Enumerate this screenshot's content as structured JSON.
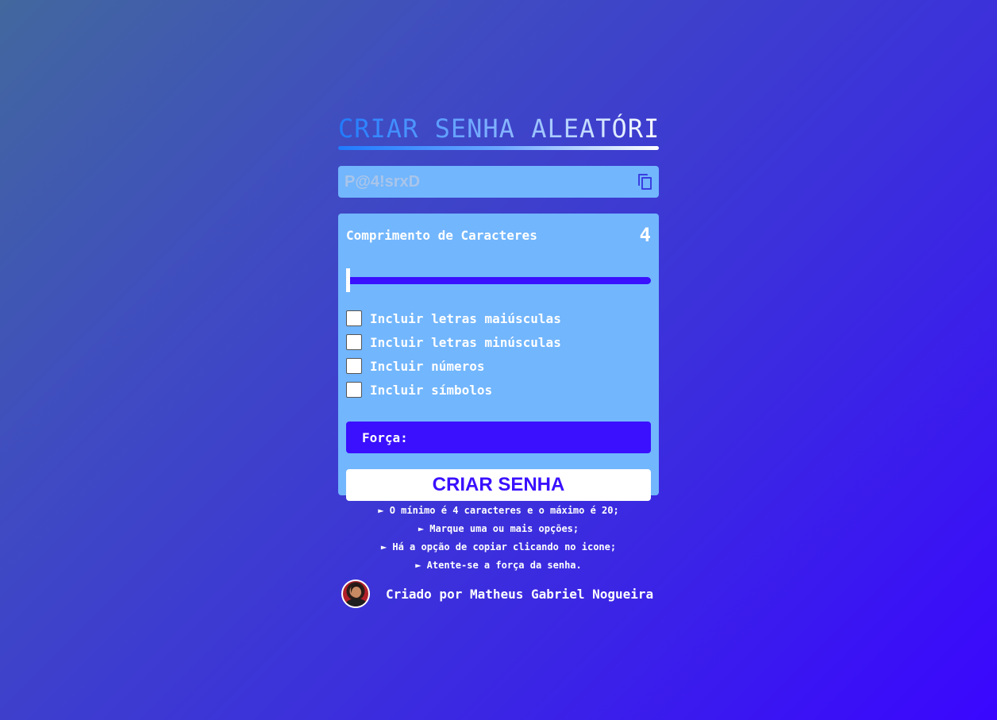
{
  "header": {
    "title": "CRIAR SENHA ALEATÓRIA"
  },
  "password": {
    "value": "P@4!srxD",
    "copy_icon": "copy-icon"
  },
  "settings": {
    "length_label": "Comprimento de Caracteres",
    "length_value": "4",
    "slider": {
      "min": 4,
      "max": 20,
      "value": 4
    },
    "options": [
      {
        "label": "Incluir letras maiúsculas",
        "checked": false
      },
      {
        "label": "Incluir letras minúsculas",
        "checked": false
      },
      {
        "label": "Incluir números",
        "checked": false
      },
      {
        "label": "Incluir símbolos",
        "checked": false
      }
    ],
    "strength_label": "Força:",
    "generate_label": "CRIAR SENHA"
  },
  "tips": [
    "► O mínimo é 4 caracteres e o máximo é 20;",
    "► Marque uma ou mais opções;",
    "► Há a opção de copiar clicando no icone;",
    "► Atente-se a força da senha."
  ],
  "footer": {
    "credit": "Criado por Matheus Gabriel Nogueira"
  },
  "colors": {
    "panel": "#72b6fd",
    "accent": "#3a10ff",
    "title_start": "#1f7bff"
  }
}
